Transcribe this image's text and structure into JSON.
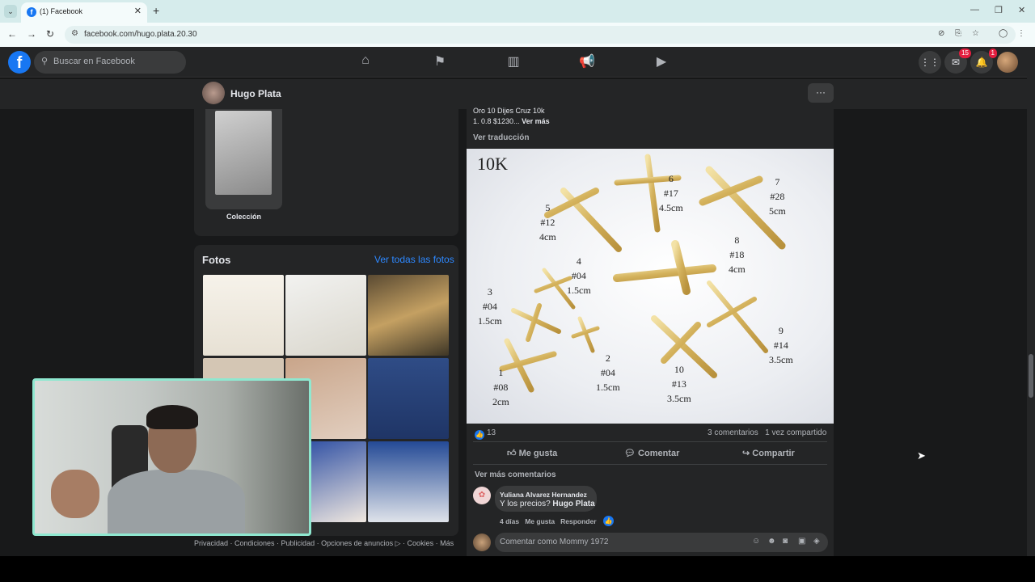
{
  "browser": {
    "tab_title": "(1) Facebook",
    "tab_favicon": "f",
    "url": "facebook.com/hugo.plata.20.30"
  },
  "topbar": {
    "search_placeholder": "Buscar en Facebook",
    "messenger_badge": "15",
    "notifications_badge": "1"
  },
  "profile": {
    "name": "Hugo Plata",
    "more": "···"
  },
  "left": {
    "collection_label": "Colección",
    "photos_title": "Fotos",
    "photos_link": "Ver todas las fotos",
    "footer": "Privacidad · Condiciones · Publicidad · Opciones de anuncios ▷ · Cookies · Más"
  },
  "post": {
    "text_line1": "Oro 10 Dijes Cruz 10k",
    "text_line2": "1. 0.8 $1230...",
    "see_more": "Ver más",
    "translate": "Ver traducción",
    "image": {
      "title": "10K",
      "labels": [
        "5\n#12\n4cm",
        "6\n#17\n4.5cm",
        "7\n#28\n5cm",
        "8\n#18\n4cm",
        "4\n#04\n1.5cm",
        "3\n#04\n1.5cm",
        "9\n#14\n3.5cm",
        "2\n#04\n1.5cm",
        "10\n#13\n3.5cm",
        "1\n#08\n2cm"
      ]
    },
    "likes": "13",
    "comments_count": "3 comentarios",
    "shares_count": "1 vez compartido",
    "like_btn": "Me gusta",
    "comment_btn": "Comentar",
    "share_btn": "Compartir",
    "more_comments": "Ver más comentarios",
    "comment": {
      "author": "Yuliana Alvarez Hernandez",
      "text": "Y los precios?",
      "mention": "Hugo Plata",
      "time": "4 días",
      "like": "Me gusta",
      "reply": "Responder"
    },
    "comment_placeholder": "Comentar como Mommy 1972"
  },
  "colors": {
    "fb_blue": "#1877f2",
    "link_blue": "#2d88ff",
    "bg": "#18191a",
    "card": "#242526",
    "webcam_border": "#8fe8d0"
  }
}
